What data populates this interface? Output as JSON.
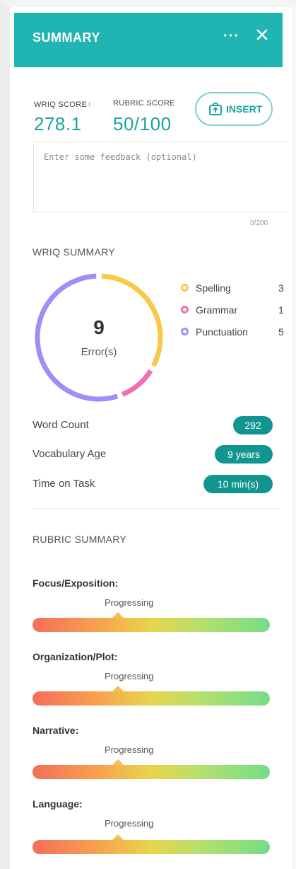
{
  "header": {
    "title": "SUMMARY",
    "more_label": "···"
  },
  "scores": {
    "wriq_label": "WRIQ SCORE",
    "wriq_value": "278.1",
    "rubric_label": "RUBRIC SCORE",
    "rubric_value": "50/100",
    "insert_label": "INSERT"
  },
  "feedback": {
    "placeholder": "Enter some feedback (optional)",
    "value": "",
    "counter": "0/200"
  },
  "wriq_summary": {
    "title": "WRIQ SUMMARY",
    "total_errors": "9",
    "errors_label": "Error(s)",
    "legend": [
      {
        "name": "Spelling",
        "count": "3",
        "color": "#f7c948"
      },
      {
        "name": "Grammar",
        "count": "1",
        "color": "#f06fb0"
      },
      {
        "name": "Punctuation",
        "count": "5",
        "color": "#9d8ff7"
      }
    ]
  },
  "stats": [
    {
      "label": "Word Count",
      "value": "292"
    },
    {
      "label": "Vocabulary Age",
      "value": "9 years"
    },
    {
      "label": "Time on Task",
      "value": "10 min(s)"
    }
  ],
  "rubric_summary": {
    "title": "RUBRIC SUMMARY",
    "criteria": [
      {
        "name": "Focus/Exposition:",
        "level": "Progressing",
        "position_fraction": 0.36
      },
      {
        "name": "Organization/Plot:",
        "level": "Progressing",
        "position_fraction": 0.36
      },
      {
        "name": "Narrative:",
        "level": "Progressing",
        "position_fraction": 0.36
      },
      {
        "name": "Language:",
        "level": "Progressing",
        "position_fraction": 0.36
      }
    ]
  },
  "colors": {
    "accent": "#20b5b3",
    "accent_dark": "#12958f",
    "score_text": "#1aa3a0"
  }
}
